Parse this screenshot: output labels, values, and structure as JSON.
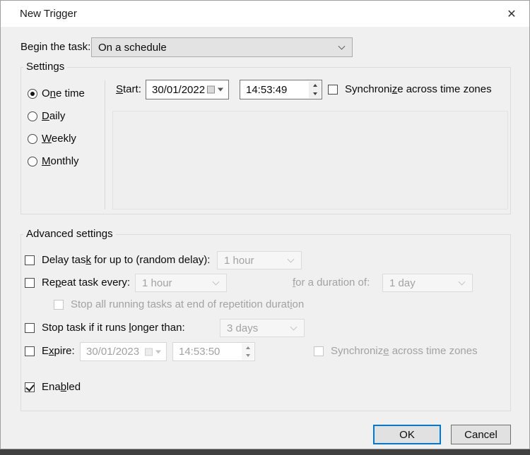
{
  "window": {
    "title": "New Trigger",
    "close_icon": "✕"
  },
  "colors": {
    "accent": "#0078d7",
    "titlebar": "#ffffff",
    "body": "#f0f0f0",
    "disabled_text": "#a2a2a2"
  },
  "icons": {
    "close": "x-close",
    "combo_chevron": "chevron-down",
    "date_picker": "calendar-with-dropdown",
    "spinner": "up-down-triangles"
  },
  "begin_task": {
    "label": {
      "pre": "Be",
      "key": "g",
      "post": "in the task:"
    },
    "value": "On a schedule"
  },
  "settings": {
    "group_label": "Settings",
    "radios": [
      {
        "pre": "O",
        "key": "n",
        "post": "e time",
        "selected": true
      },
      {
        "pre": "",
        "key": "D",
        "post": "aily",
        "selected": false
      },
      {
        "pre": "",
        "key": "W",
        "post": "eekly",
        "selected": false
      },
      {
        "pre": "",
        "key": "M",
        "post": "onthly",
        "selected": false
      }
    ],
    "start": {
      "label": {
        "pre": "",
        "key": "S",
        "post": "tart:"
      },
      "date": "30/01/2022",
      "time": "14:53:49"
    },
    "sync": {
      "pre": "Synchroni",
      "key": "z",
      "post": "e across time zones",
      "checked": false
    }
  },
  "advanced": {
    "group_label": "Advanced settings",
    "delay": {
      "label": {
        "pre": "Delay tas",
        "key": "k",
        "post": " for up to (random delay):"
      },
      "value": "1 hour",
      "checked": false
    },
    "repeat": {
      "label": {
        "pre": "Re",
        "key": "p",
        "post": "eat task every:"
      },
      "value": "1 hour",
      "checked": false
    },
    "duration": {
      "label": {
        "pre": "",
        "key": "f",
        "post": "or a duration of:"
      },
      "value": "1 day"
    },
    "stop_all": {
      "label": {
        "pre": "Stop all running tasks at end of repetition durat",
        "key": "i",
        "post": "on"
      },
      "checked": false
    },
    "stop_task": {
      "label": {
        "pre": "Stop task if it runs ",
        "key": "l",
        "post": "onger than:"
      },
      "value": "3 days",
      "checked": false
    },
    "expire": {
      "label": {
        "pre": "E",
        "key": "x",
        "post": "pire:"
      },
      "date": "30/01/2023",
      "time": "14:53:50",
      "checked": false
    },
    "expire_sync": {
      "pre": "Synchroniz",
      "key": "e",
      "post": " across time zones",
      "checked": false
    },
    "enabled": {
      "label": {
        "pre": "Ena",
        "key": "b",
        "post": "led"
      },
      "checked": true
    }
  },
  "buttons": {
    "ok": "OK",
    "cancel": "Cancel"
  }
}
